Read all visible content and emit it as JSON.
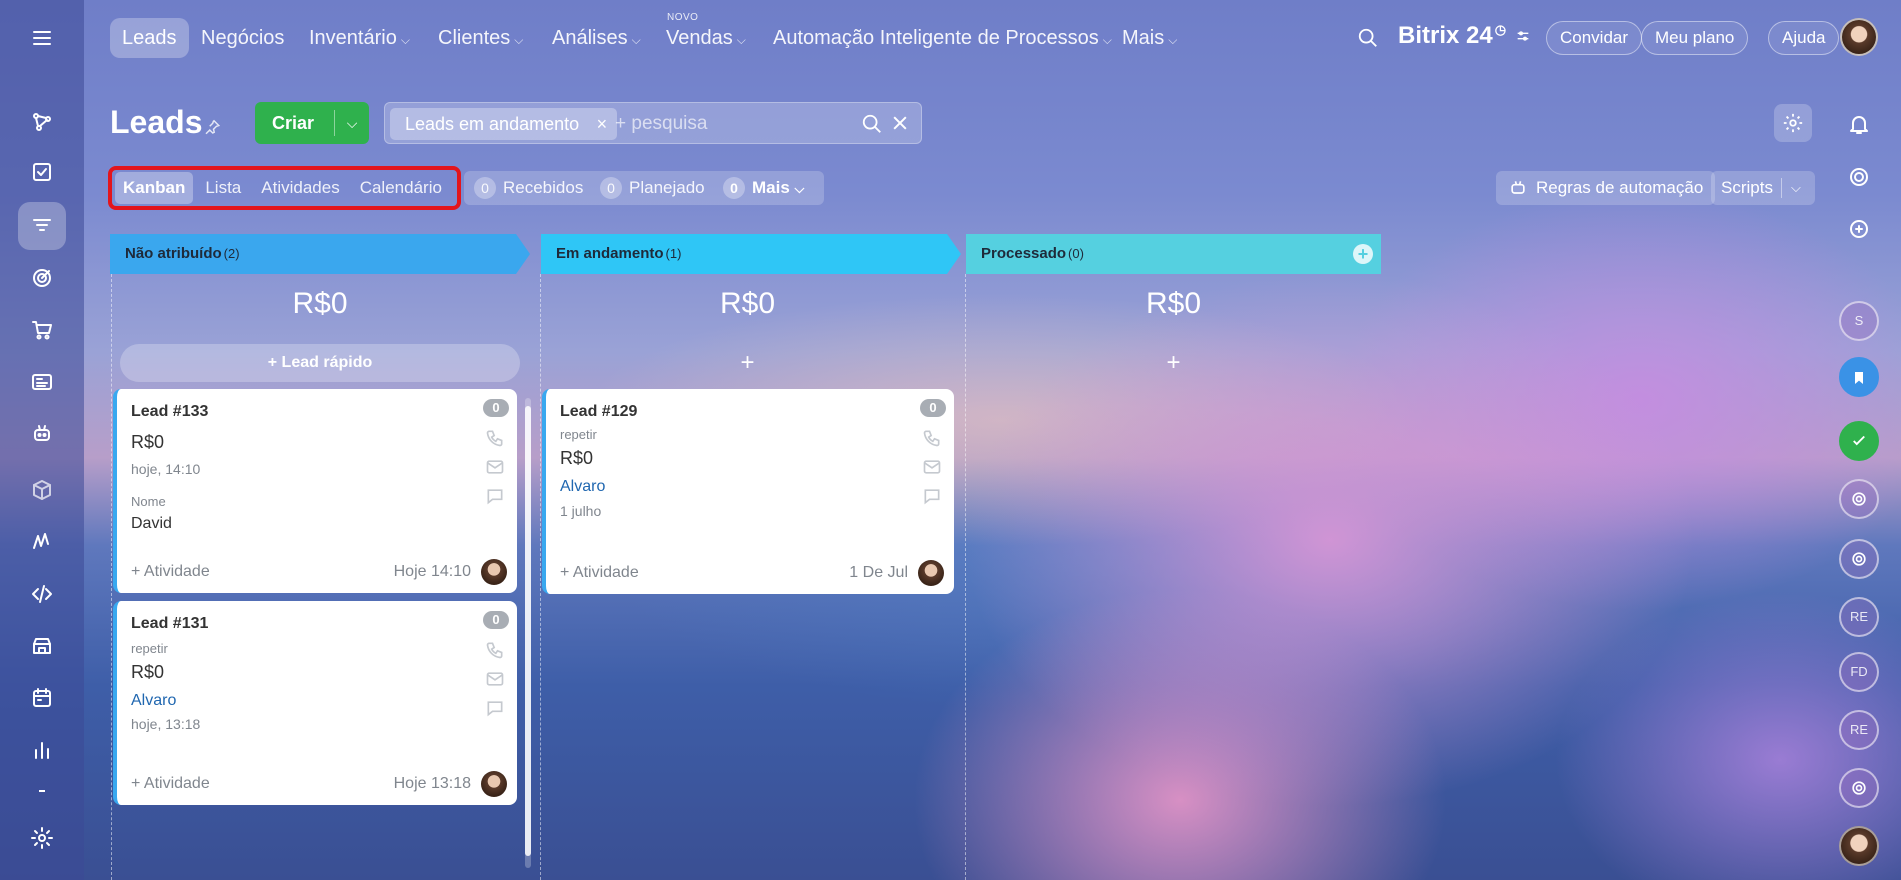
{
  "nav": {
    "items": [
      {
        "label": "Leads",
        "caret": false
      },
      {
        "label": "Negócios",
        "caret": false
      },
      {
        "label": "Inventário",
        "caret": true
      },
      {
        "label": "Clientes",
        "caret": true
      },
      {
        "label": "Análises",
        "caret": true
      },
      {
        "label": "Vendas",
        "caret": true
      },
      {
        "label": "Automação Inteligente de Processos",
        "caret": true
      },
      {
        "label": "Mais",
        "caret": true
      }
    ],
    "novo_badge": "NOVO",
    "brand": "Bitrix 24",
    "invite": "Convidar",
    "plan": "Meu plano",
    "help": "Ajuda"
  },
  "header": {
    "title": "Leads",
    "create_label": "Criar",
    "filter_chip": "Leads em andamento",
    "search_placeholder": "+ pesquisa"
  },
  "views": {
    "tabs": [
      "Kanban",
      "Lista",
      "Atividades",
      "Calendário"
    ],
    "active": "Kanban"
  },
  "counters": [
    {
      "count": "0",
      "label": "Recebidos"
    },
    {
      "count": "0",
      "label": "Planejado"
    },
    {
      "count": "0",
      "label": "Mais"
    }
  ],
  "automation_label": "Regras de automação",
  "scripts_label": "Scripts",
  "columns": [
    {
      "name": "Não atribuído",
      "count": "(2)",
      "sum": "R$0",
      "color": "#3aa7ee",
      "add_label": "+ Lead rápido"
    },
    {
      "name": "Em andamento",
      "count": "(1)",
      "sum": "R$0",
      "color": "#2fc6f6",
      "add_label": "+"
    },
    {
      "name": "Processado",
      "count": "(0)",
      "sum": "R$0",
      "color": "#55d0e0",
      "add_label": "+"
    }
  ],
  "cards": [
    {
      "title": "Lead #133",
      "counter": "0",
      "amount": "R$0",
      "created": "hoje, 14:10",
      "field_label": "Nome",
      "field_value": "David",
      "activity": "+ Atividade",
      "date": "Hoje 14:10"
    },
    {
      "title": "Lead #131",
      "counter": "0",
      "repeat": "repetir",
      "amount": "R$0",
      "contact": "Alvaro",
      "created": "hoje, 13:18",
      "activity": "+ Atividade",
      "date": "Hoje 13:18"
    },
    {
      "title": "Lead #129",
      "counter": "0",
      "repeat": "repetir",
      "amount": "R$0",
      "contact": "Alvaro",
      "created": "1 julho",
      "activity": "+ Atividade",
      "date": "1 De Jul"
    }
  ],
  "rail": [
    "S",
    "RE",
    "FD",
    "RE"
  ],
  "colors": {
    "accent_green": "#2fb14d",
    "link_blue": "#2067b0",
    "highlight_red": "#e3151c"
  }
}
